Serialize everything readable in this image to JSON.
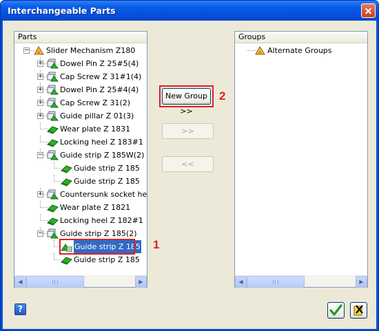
{
  "window": {
    "title": "Interchangeable Parts"
  },
  "parts_panel": {
    "header": "Parts",
    "items": [
      {
        "label": "Slider Mechanism Z180",
        "level": 0,
        "expander": "−",
        "icon": "assembly-icon"
      },
      {
        "label": "Dowel Pin Z 25#5(4)",
        "level": 1,
        "expander": "+",
        "icon": "component-group-icon"
      },
      {
        "label": "Cap Screw Z 31#1(4)",
        "level": 1,
        "expander": "+",
        "icon": "component-group-icon"
      },
      {
        "label": "Dowel Pin Z 25#4(4)",
        "level": 1,
        "expander": "+",
        "icon": "component-group-icon"
      },
      {
        "label": "Cap Screw Z 31(2)",
        "level": 1,
        "expander": "+",
        "icon": "component-group-icon"
      },
      {
        "label": "Guide pillar Z 01(3)",
        "level": 1,
        "expander": "+",
        "icon": "component-group-icon"
      },
      {
        "label": "Wear plate Z 1831",
        "level": 1,
        "expander": "",
        "icon": "part-icon"
      },
      {
        "label": "Locking heel Z 183#1",
        "level": 1,
        "expander": "",
        "icon": "part-icon"
      },
      {
        "label": "Guide strip Z 185W(2)",
        "level": 1,
        "expander": "−",
        "icon": "component-group-icon"
      },
      {
        "label": "Guide strip Z 185",
        "level": 2,
        "expander": "",
        "icon": "part-icon"
      },
      {
        "label": "Guide strip Z 185",
        "level": 2,
        "expander": "",
        "icon": "part-icon"
      },
      {
        "label": "Countersunk socket he",
        "level": 1,
        "expander": "+",
        "icon": "component-group-icon"
      },
      {
        "label": "Wear plate Z 1821",
        "level": 1,
        "expander": "",
        "icon": "part-icon"
      },
      {
        "label": "Locking heel Z 182#1",
        "level": 1,
        "expander": "",
        "icon": "part-icon"
      },
      {
        "label": "Guide strip Z 185(2)",
        "level": 1,
        "expander": "−",
        "icon": "component-group-icon"
      },
      {
        "label": "Guide strip Z 185",
        "level": 2,
        "expander": "",
        "icon": "part-selected-icon",
        "selected": true
      },
      {
        "label": "Guide strip Z 185",
        "level": 2,
        "expander": "",
        "icon": "part-icon"
      }
    ]
  },
  "groups_panel": {
    "header": "Groups",
    "items": [
      {
        "label": "Alternate Groups",
        "icon": "assembly-icon"
      }
    ]
  },
  "buttons": {
    "new_group": "New Group >>",
    "move_right": ">>",
    "move_left": "<<"
  },
  "callouts": {
    "one": "1",
    "two": "2"
  },
  "footer": {
    "help": "?"
  },
  "colors": {
    "accent": "#0a5de8",
    "selection": "#316ac5",
    "callout": "#e02020"
  }
}
